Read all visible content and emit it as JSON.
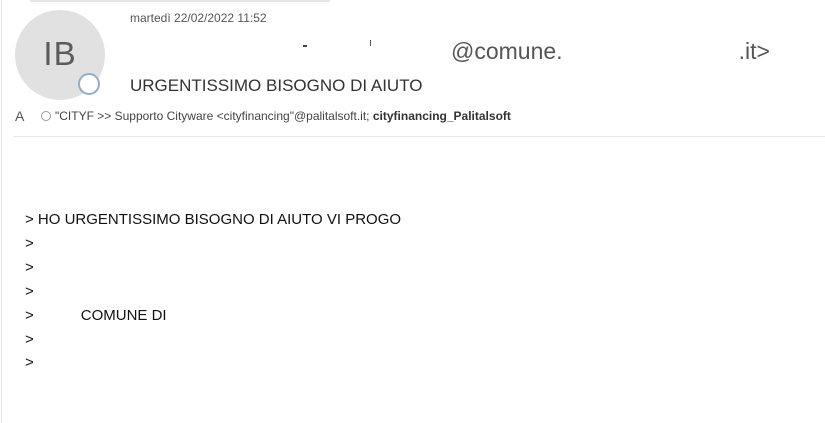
{
  "email": {
    "date": "martedì 22/02/2022 11:52",
    "avatar_initials": "IB",
    "sender_domain_start": "@comune.",
    "sender_domain_end": ".it>",
    "subject": "URGENTISSIMO BISOGNO DI AIUTO",
    "recipient_label": "A",
    "recipient_primary": "\"CITYF >> Supporto Cityware <cityfinancing\"@palitalsoft.it;",
    "recipient_secondary": "cityfinancing_Palitalsoft"
  },
  "body": {
    "line_1": "> HO URGENTISSIMO BISOGNO DI AIUTO VI PROGO",
    "line_2": ">",
    "line_3": ">",
    "line_4": ">",
    "line_5_prefix": ">",
    "line_5_text": "COMUNE DI",
    "line_6": ">",
    "line_7": ">"
  }
}
